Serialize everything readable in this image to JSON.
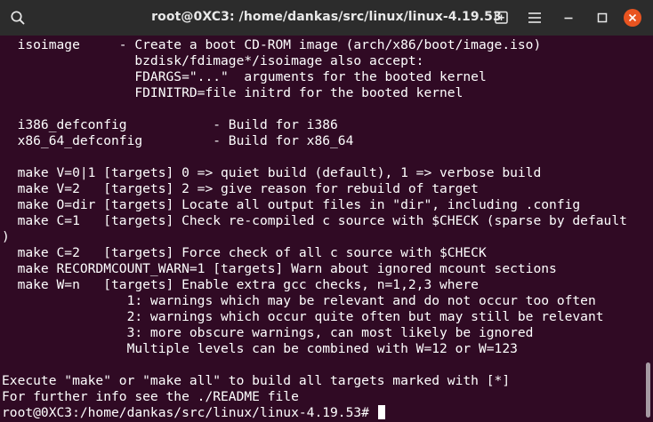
{
  "window": {
    "title": "root@0XC3: /home/dankas/src/linux/linux-4.19.53"
  },
  "titlebar": {
    "icons": [
      "search-icon",
      "new-tab-icon",
      "menu-icon",
      "minimize-icon",
      "maximize-icon",
      "close-icon"
    ],
    "close_color": "#e95420",
    "bar_color": "#2c2c2c"
  },
  "terminal": {
    "background": "#300a24",
    "foreground": "#ffffff",
    "lines": [
      "  isoimage     - Create a boot CD-ROM image (arch/x86/boot/image.iso)",
      "                 bzdisk/fdimage*/isoimage also accept:",
      "                 FDARGS=\"...\"  arguments for the booted kernel",
      "                 FDINITRD=file initrd for the booted kernel",
      "",
      "  i386_defconfig           - Build for i386",
      "  x86_64_defconfig         - Build for x86_64",
      "",
      "  make V=0|1 [targets] 0 => quiet build (default), 1 => verbose build",
      "  make V=2   [targets] 2 => give reason for rebuild of target",
      "  make O=dir [targets] Locate all output files in \"dir\", including .config",
      "  make C=1   [targets] Check re-compiled c source with $CHECK (sparse by default",
      ")",
      "  make C=2   [targets] Force check of all c source with $CHECK",
      "  make RECORDMCOUNT_WARN=1 [targets] Warn about ignored mcount sections",
      "  make W=n   [targets] Enable extra gcc checks, n=1,2,3 where",
      "                1: warnings which may be relevant and do not occur too often",
      "                2: warnings which occur quite often but may still be relevant",
      "                3: more obscure warnings, can most likely be ignored",
      "                Multiple levels can be combined with W=12 or W=123",
      "",
      "Execute \"make\" or \"make all\" to build all targets marked with [*]",
      "For further info see the ./README file"
    ],
    "prompt": "root@0XC3:/home/dankas/src/linux/linux-4.19.53# "
  }
}
